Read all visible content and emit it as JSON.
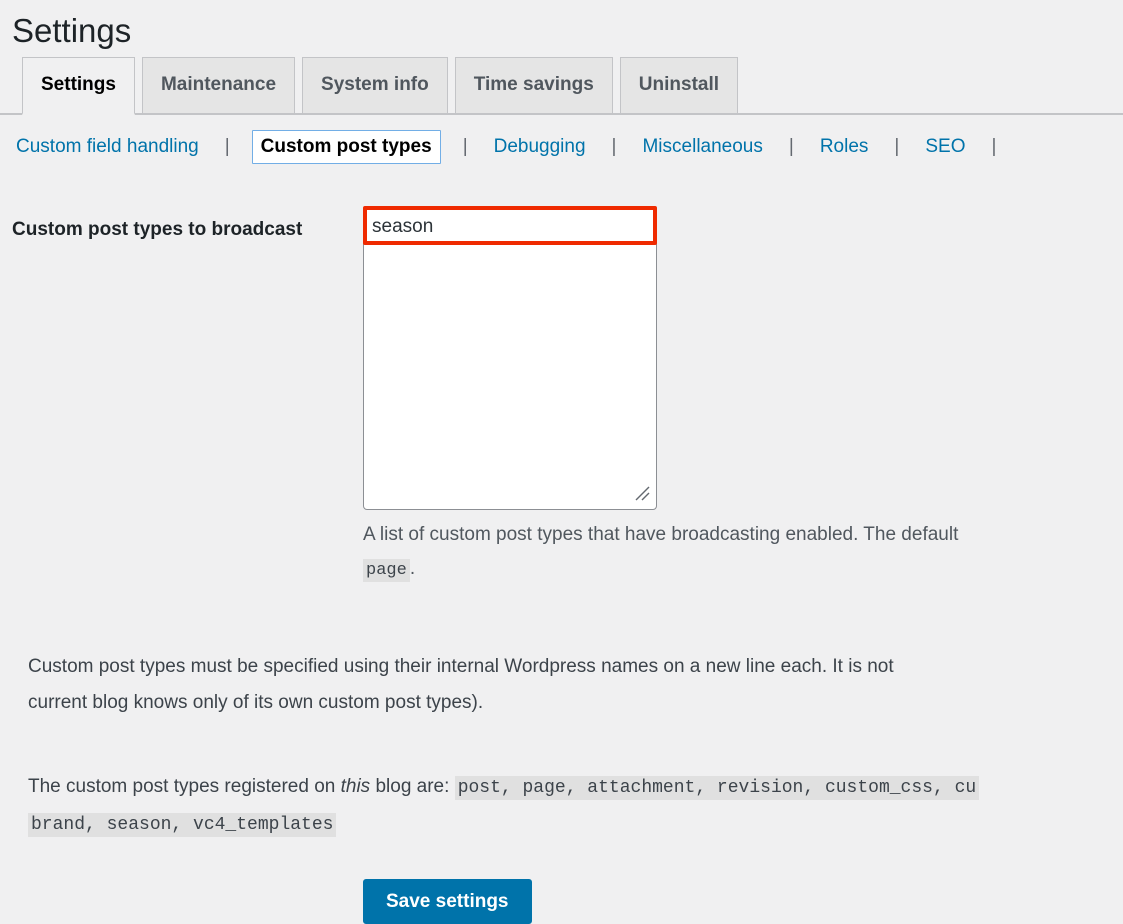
{
  "page": {
    "title": "Settings"
  },
  "tabs": [
    {
      "label": "Settings",
      "active": true
    },
    {
      "label": "Maintenance",
      "active": false
    },
    {
      "label": "System info",
      "active": false
    },
    {
      "label": "Time savings",
      "active": false
    },
    {
      "label": "Uninstall",
      "active": false
    }
  ],
  "subnav": {
    "separator": "|",
    "items": [
      {
        "label": "Custom field handling",
        "current": false
      },
      {
        "label": "Custom post types",
        "current": true
      },
      {
        "label": "Debugging",
        "current": false
      },
      {
        "label": "Miscellaneous",
        "current": false
      },
      {
        "label": "Roles",
        "current": false
      },
      {
        "label": "SEO",
        "current": false
      }
    ],
    "trailing_separator": "|"
  },
  "form": {
    "field_label": "Custom post types to broadcast",
    "textarea_value": "season",
    "textarea_placeholder": "",
    "description_line1": "A list of custom post types that have broadcasting enabled. The default",
    "description_code": "page",
    "description_line2_tail": "."
  },
  "paragraphs": {
    "p1": "Custom post types must be specified using their internal Wordpress names on a new line each. It is not current blog knows only of its own custom post types).",
    "p1_line1": "Custom post types must be specified using their internal Wordpress names on a new line each. It is not",
    "p1_line2": "current blog knows only of its own custom post types).",
    "p2_prefix": "The custom post types registered on ",
    "p2_emphasis": "this",
    "p2_middle": " blog are: ",
    "p2_code": "post, page, attachment, revision, custom_css, cu",
    "p2_code_line2": "brand, season, vc4_templates"
  },
  "actions": {
    "save_label": "Save settings"
  },
  "colors": {
    "accent_link": "#0073aa",
    "button_bg": "#0073aa",
    "annotation_red": "#ef2a00",
    "page_bg": "#f0f0f1",
    "tab_inactive_bg": "#e5e5e5",
    "code_bg": "#e0e0e0",
    "current_subnav_border": "#72aee6"
  }
}
